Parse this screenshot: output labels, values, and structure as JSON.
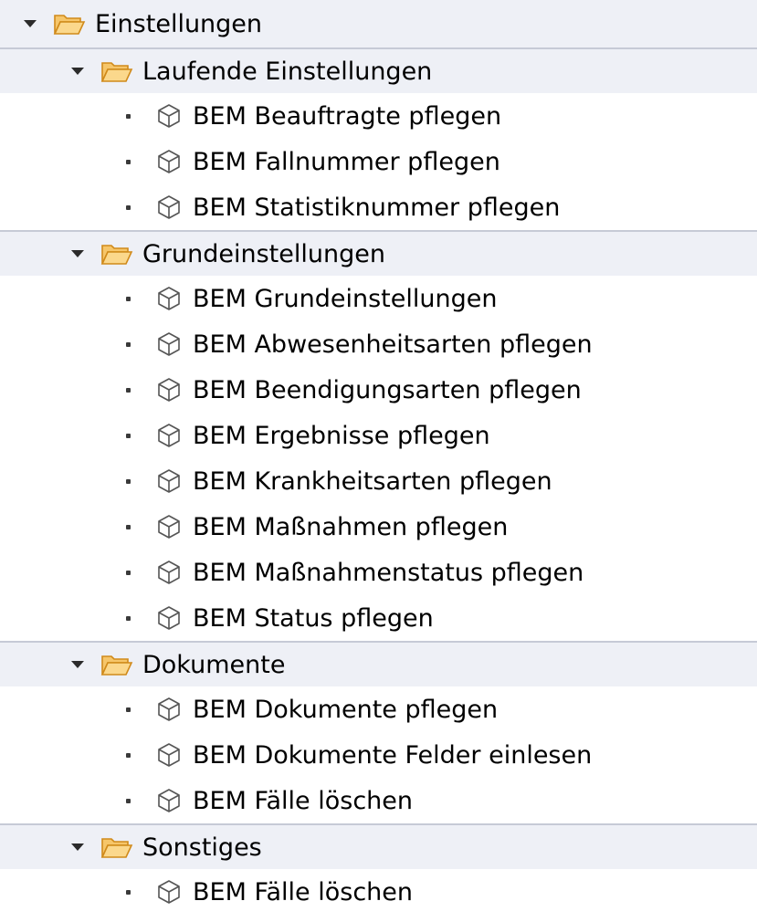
{
  "tree": {
    "root": {
      "label": "Einstellungen",
      "expanded": true,
      "icon": "folder-open-icon"
    },
    "groups": [
      {
        "label": "Laufende Einstellungen",
        "icon": "folder-open-icon",
        "items": [
          {
            "label": "BEM Beauftragte pflegen",
            "icon": "cube-icon"
          },
          {
            "label": "BEM Fallnummer pflegen",
            "icon": "cube-icon"
          },
          {
            "label": "BEM Statistiknummer pflegen",
            "icon": "cube-icon"
          }
        ]
      },
      {
        "label": "Grundeinstellungen",
        "icon": "folder-open-icon",
        "items": [
          {
            "label": "BEM Grundeinstellungen",
            "icon": "cube-icon"
          },
          {
            "label": "BEM Abwesenheitsarten pflegen",
            "icon": "cube-icon"
          },
          {
            "label": "BEM Beendigungsarten pflegen",
            "icon": "cube-icon"
          },
          {
            "label": "BEM Ergebnisse pflegen",
            "icon": "cube-icon"
          },
          {
            "label": "BEM Krankheitsarten pflegen",
            "icon": "cube-icon"
          },
          {
            "label": "BEM Maßnahmen pflegen",
            "icon": "cube-icon"
          },
          {
            "label": "BEM Maßnahmenstatus pflegen",
            "icon": "cube-icon"
          },
          {
            "label": "BEM Status pflegen",
            "icon": "cube-icon"
          }
        ]
      },
      {
        "label": "Dokumente",
        "icon": "folder-open-icon",
        "items": [
          {
            "label": "BEM Dokumente pflegen",
            "icon": "cube-icon"
          },
          {
            "label": "BEM Dokumente Felder einlesen",
            "icon": "cube-icon"
          },
          {
            "label": "BEM Fälle löschen",
            "icon": "cube-icon"
          }
        ]
      },
      {
        "label": "Sonstiges",
        "icon": "folder-open-icon",
        "items": [
          {
            "label": "BEM Fälle löschen",
            "icon": "cube-icon"
          }
        ]
      }
    ]
  },
  "colors": {
    "folder_fill": "#f6c66a",
    "folder_stroke": "#d08a1a",
    "folder_row_bg": "#eef0f6",
    "separator": "#c6cad6",
    "text": "#000000"
  }
}
